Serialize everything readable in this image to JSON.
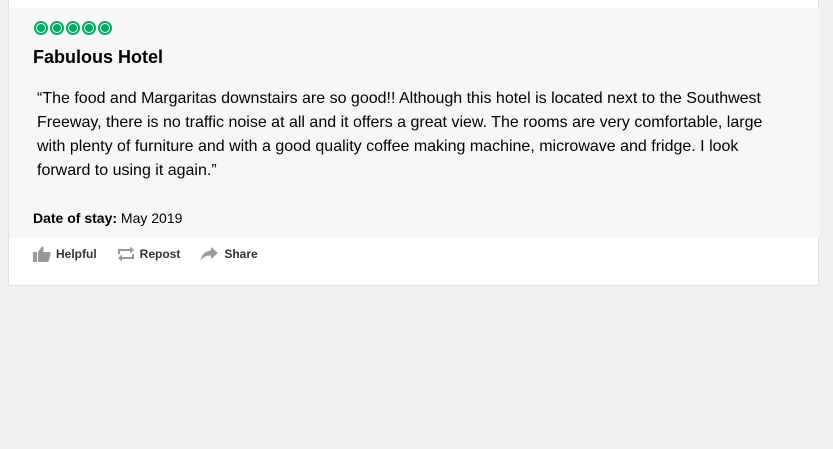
{
  "review": {
    "rating": 5,
    "rating_max": 5,
    "title": "Fabulous Hotel",
    "text": "“The food and Margaritas downstairs are so good!! Although this hotel is located next to the Southwest Freeway, there is no traffic noise at all and it offers a great view. The rooms are very comfortable, large with plenty of furniture and with a good quality coffee making machine, microwave and fridge. I look forward to using it again.”",
    "date_of_stay_label": "Date of stay:",
    "date_of_stay_value": "May 2019"
  },
  "actions": {
    "helpful_label": "Helpful",
    "repost_label": "Repost",
    "share_label": "Share"
  },
  "colors": {
    "rating_green": "#00aa6c",
    "page_background": "#efefef",
    "review_background": "#f6f6f6",
    "icon_gray": "#999999"
  },
  "icons": {
    "helpful": "thumbs-up-icon",
    "repost": "repost-icon",
    "share": "share-arrow-icon"
  }
}
